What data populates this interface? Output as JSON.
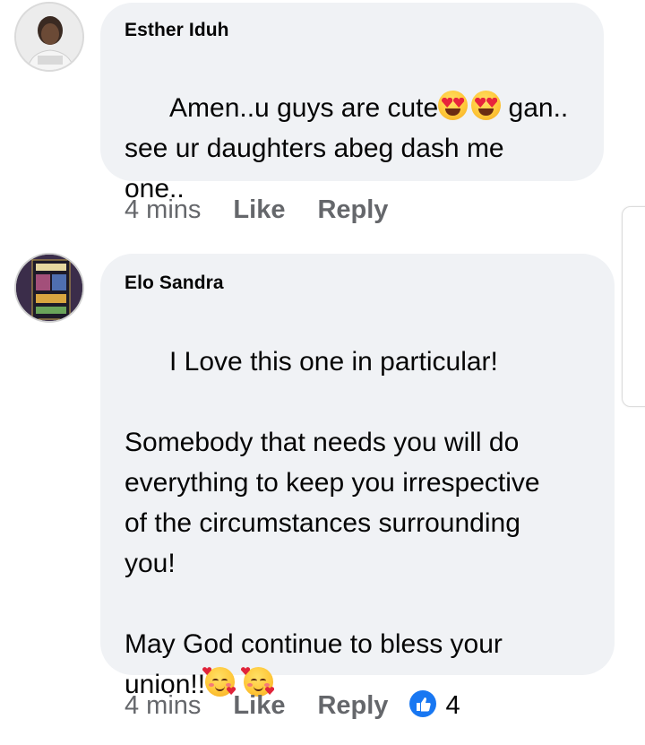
{
  "comments": [
    {
      "author": "Esther Iduh",
      "text_line1_a": "Amen..u guys are cute",
      "text_line1_b": " gan..",
      "text_rest": "see ur daughters abeg dash me\none..",
      "emoji": "heart-eyes-emoji",
      "time": "4 mins",
      "like_label": "Like",
      "reply_label": "Reply"
    },
    {
      "author": "Elo Sandra",
      "text": "I Love this one in particular!\n\nSomebody that needs you will do\neverything to keep you irrespective\nof the circumstances surrounding\nyou!\n\nMay God continue to bless your",
      "text_last": "union!!",
      "emoji": "smiling-face-with-hearts-emoji",
      "time": "4 mins",
      "like_label": "Like",
      "reply_label": "Reply",
      "reaction_count": "4"
    }
  ],
  "colors": {
    "bubble": "#f0f2f5",
    "meta_text": "#65676b",
    "like_blue": "#1877f2"
  }
}
